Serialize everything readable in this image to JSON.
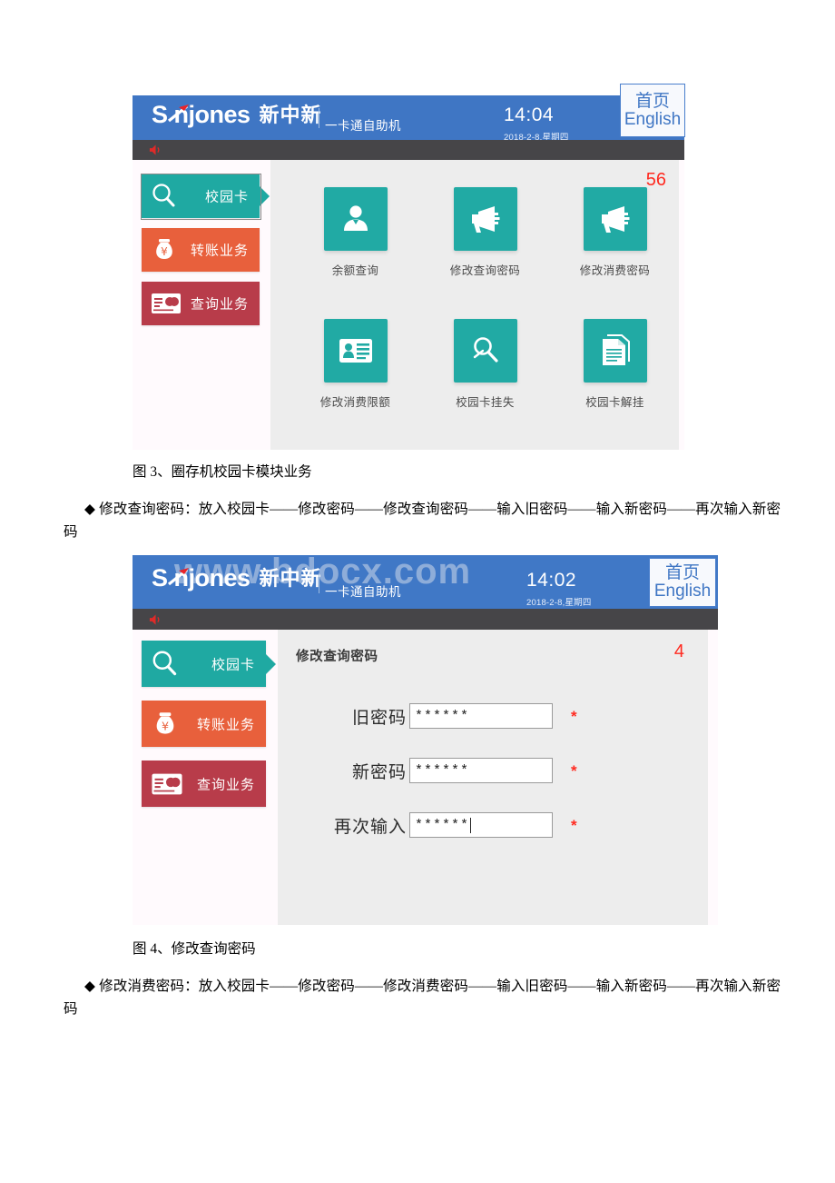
{
  "doc": {
    "caption_fig3": "图 3、圈存机校园卡模块业务",
    "para_fig3": "◆ 修改查询密码：放入校园卡——修改密码——修改查询密码——输入旧密码——输入新密码——再次输入新密码",
    "caption_fig4": "图 4、修改查询密码",
    "para_fig4": "◆ 修改消费密码：放入校园卡——修改密码——修改消费密码——输入旧密码——输入新密码——再次输入新密码"
  },
  "shot1": {
    "header": {
      "logo_text": "S njones",
      "logo_cn": "新中新",
      "subtitle": "一卡通自助机",
      "time": "14:04",
      "date": "2018-2-8,星期四",
      "home_cn": "首页",
      "home_en": "English",
      "speaker_icon": "speaker-icon",
      "bg_color": "#3f76c4"
    },
    "sidebar": [
      {
        "label": "校园卡",
        "icon": "magnifier-icon",
        "color": "#1fa9a2",
        "selected": true
      },
      {
        "label": "转账业务",
        "icon": "money-bag-icon",
        "color": "#e8603c",
        "selected": false
      },
      {
        "label": "查询业务",
        "icon": "bank-card-icon",
        "color": "#b83c4a",
        "selected": false
      }
    ],
    "corner_number": "56",
    "tiles": [
      {
        "label": "余额查询",
        "icon": "person-icon"
      },
      {
        "label": "修改查询密码",
        "icon": "megaphone-icon"
      },
      {
        "label": "修改消费密码",
        "icon": "megaphone-icon"
      },
      {
        "label": "修改消费限额",
        "icon": "id-card-icon"
      },
      {
        "label": "校园卡挂失",
        "icon": "magnifier-search-icon"
      },
      {
        "label": "校园卡解挂",
        "icon": "documents-icon"
      }
    ]
  },
  "shot2": {
    "header": {
      "logo_text": "S njones",
      "logo_cn": "新中新",
      "subtitle": "一卡通自助机",
      "time": "14:02",
      "date": "2018-2-8,星期四",
      "home_cn": "首页",
      "home_en": "English",
      "speaker_icon": "speaker-icon",
      "watermark": "www.bdocx.com",
      "bg_color": "#4078c6"
    },
    "sidebar": [
      {
        "label": "校园卡",
        "icon": "magnifier-icon",
        "color": "#1fa9a2",
        "selected": true
      },
      {
        "label": "转账业务",
        "icon": "money-bag-icon",
        "color": "#e8603c",
        "selected": false
      },
      {
        "label": "查询业务",
        "icon": "bank-card-icon",
        "color": "#b83c4a",
        "selected": false
      }
    ],
    "form": {
      "title": "修改查询密码",
      "corner_number": "4",
      "required_mark": "*",
      "fields": [
        {
          "label": "旧密码",
          "value": "******",
          "focused": false
        },
        {
          "label": "新密码",
          "value": "******",
          "focused": false
        },
        {
          "label": "再次输入",
          "value": "******",
          "focused": true
        }
      ]
    }
  }
}
